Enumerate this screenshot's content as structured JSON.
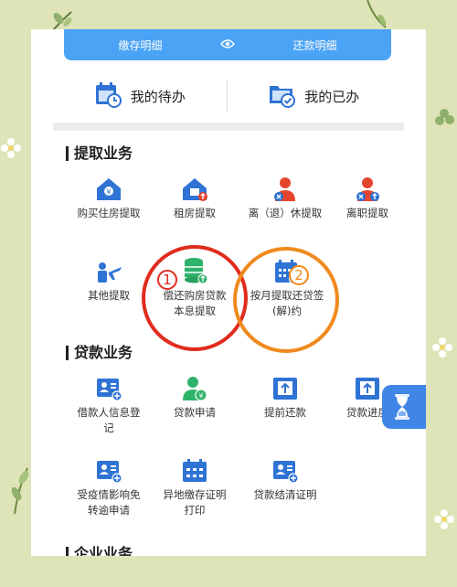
{
  "top_tabs": {
    "left": "缴存明细",
    "right": "还款明细"
  },
  "todo": {
    "pending": "我的待办",
    "done": "我的已办"
  },
  "sections": {
    "withdrawal": {
      "title": "提取业务",
      "items": [
        {
          "label": "购买住房提取",
          "icon": "house-yuan-icon"
        },
        {
          "label": "租房提取",
          "icon": "house-rent-icon"
        },
        {
          "label": "离（退）休提取",
          "icon": "person-retire-icon"
        },
        {
          "label": "离职提取",
          "icon": "person-leave-icon"
        },
        {
          "label": "其他提取",
          "icon": "person-plane-icon"
        },
        {
          "label": "偿还购房贷款本息提取",
          "icon": "coins-stack-icon"
        },
        {
          "label": "按月提取还贷签(解)约",
          "icon": "calendar-person-icon"
        }
      ]
    },
    "loan": {
      "title": "贷款业务",
      "items": [
        {
          "label": "借款人信息登记",
          "icon": "id-card-add-icon"
        },
        {
          "label": "贷款申请",
          "icon": "person-yuan-icon"
        },
        {
          "label": "提前还款",
          "icon": "upload-tray-icon"
        },
        {
          "label": "贷款进度",
          "icon": "upload-tray-icon"
        },
        {
          "label": "受疫情影响免转逾申请",
          "icon": "id-card-add-icon"
        },
        {
          "label": "异地缴存证明打印",
          "icon": "calendar-grid-icon"
        },
        {
          "label": "贷款结清证明",
          "icon": "id-card-add-icon"
        }
      ]
    },
    "corporate": {
      "title": "企业业务"
    }
  },
  "annotations": {
    "first": "1",
    "second": "2"
  },
  "colors": {
    "blue": "#2f73d4",
    "red": "#e5452c",
    "green": "#2fb36b",
    "circle_red": "#e02c1e",
    "circle_orange": "#f08a1e"
  }
}
